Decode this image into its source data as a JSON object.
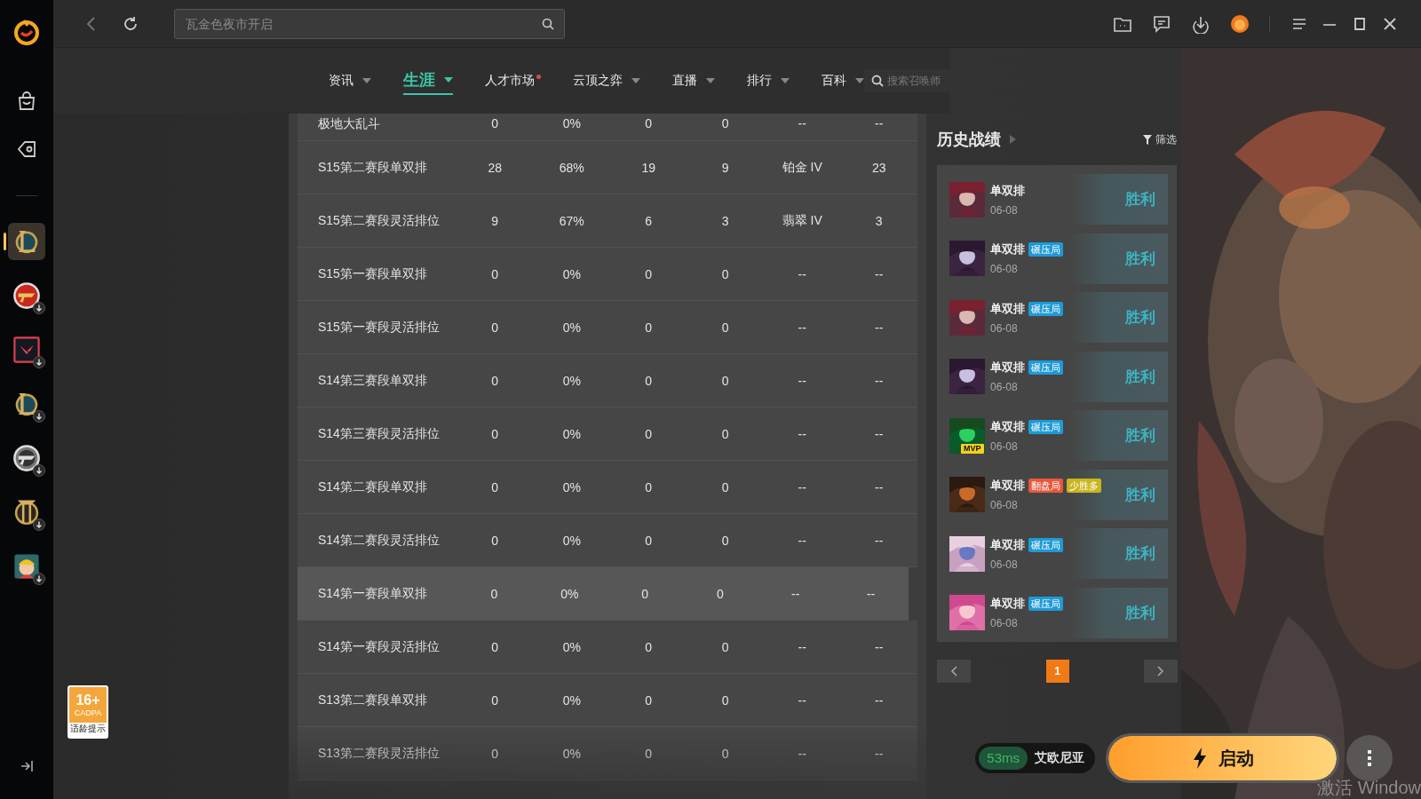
{
  "sidebar": {
    "games": [
      {
        "kind": "ring",
        "selected": true,
        "installed": true
      },
      {
        "kind": "badge",
        "selected": false,
        "installed": false
      },
      {
        "kind": "square",
        "selected": false,
        "installed": false
      },
      {
        "kind": "ring",
        "selected": false,
        "installed": false
      },
      {
        "kind": "silver",
        "selected": false,
        "installed": false
      },
      {
        "kind": "gate",
        "selected": false,
        "installed": false
      },
      {
        "kind": "tile",
        "selected": false,
        "installed": false
      }
    ],
    "age_rating": {
      "value": "16+",
      "org": "CADPA",
      "caption": "适龄提示"
    }
  },
  "top_bar": {
    "search": {
      "placeholder": "瓦金色夜市开启"
    }
  },
  "nav": {
    "items": [
      {
        "label": "资讯",
        "selected": false,
        "dropdown": true,
        "dot": false
      },
      {
        "label": "生涯",
        "selected": true,
        "dropdown": true,
        "dot": false
      },
      {
        "label": "人才市场",
        "selected": false,
        "dropdown": false,
        "dot": true
      },
      {
        "label": "云顶之弈",
        "selected": false,
        "dropdown": true,
        "dot": false
      },
      {
        "label": "直播",
        "selected": false,
        "dropdown": true,
        "dot": false
      },
      {
        "label": "排行",
        "selected": false,
        "dropdown": true,
        "dot": false
      },
      {
        "label": "百科",
        "selected": false,
        "dropdown": true,
        "dot": false
      }
    ],
    "search": {
      "placeholder": "搜索召唤师"
    }
  },
  "table": {
    "rows": [
      {
        "cells": [
          "极地大乱斗",
          "0",
          "0%",
          "0",
          "0",
          "--",
          "--"
        ],
        "selected": false
      },
      {
        "cells": [
          "S15第二赛段单双排",
          "28",
          "68%",
          "19",
          "9",
          "铂金 IV",
          "23"
        ],
        "selected": false
      },
      {
        "cells": [
          "S15第二赛段灵活排位",
          "9",
          "67%",
          "6",
          "3",
          "翡翠 IV",
          "3"
        ],
        "selected": false
      },
      {
        "cells": [
          "S15第一赛段单双排",
          "0",
          "0%",
          "0",
          "0",
          "--",
          "--"
        ],
        "selected": false
      },
      {
        "cells": [
          "S15第一赛段灵活排位",
          "0",
          "0%",
          "0",
          "0",
          "--",
          "--"
        ],
        "selected": false
      },
      {
        "cells": [
          "S14第三赛段单双排",
          "0",
          "0%",
          "0",
          "0",
          "--",
          "--"
        ],
        "selected": false
      },
      {
        "cells": [
          "S14第三赛段灵活排位",
          "0",
          "0%",
          "0",
          "0",
          "--",
          "--"
        ],
        "selected": false
      },
      {
        "cells": [
          "S14第二赛段单双排",
          "0",
          "0%",
          "0",
          "0",
          "--",
          "--"
        ],
        "selected": false
      },
      {
        "cells": [
          "S14第二赛段灵活排位",
          "0",
          "0%",
          "0",
          "0",
          "--",
          "--"
        ],
        "selected": false
      },
      {
        "cells": [
          "S14第一赛段单双排",
          "0",
          "0%",
          "0",
          "0",
          "--",
          "--"
        ],
        "selected": true
      },
      {
        "cells": [
          "S14第一赛段灵活排位",
          "0",
          "0%",
          "0",
          "0",
          "--",
          "--"
        ],
        "selected": false
      },
      {
        "cells": [
          "S13第二赛段单双排",
          "0",
          "0%",
          "0",
          "0",
          "--",
          "--"
        ],
        "selected": false
      },
      {
        "cells": [
          "S13第二赛段灵活排位",
          "0",
          "0%",
          "0",
          "0",
          "--",
          "--"
        ],
        "selected": false
      }
    ]
  },
  "history": {
    "title": "历史战绩",
    "filter": "筛选",
    "matches": [
      {
        "mode": "单双排",
        "date": "06-08",
        "result": "胜利"
      },
      {
        "mode": "单双排",
        "tags": [
          {
            "label": "碾压局",
            "color": "#1e9ad6"
          }
        ],
        "date": "06-08",
        "result": "胜利"
      },
      {
        "mode": "单双排",
        "tags": [
          {
            "label": "碾压局",
            "color": "#1e9ad6"
          }
        ],
        "date": "06-08",
        "result": "胜利"
      },
      {
        "mode": "单双排",
        "tags": [
          {
            "label": "碾压局",
            "color": "#1e9ad6"
          }
        ],
        "date": "06-08",
        "result": "胜利"
      },
      {
        "mode": "单双排",
        "tags": [
          {
            "label": "碾压局",
            "color": "#1e9ad6"
          }
        ],
        "date": "06-08",
        "result": "胜利",
        "badge": "MVP"
      },
      {
        "mode": "单双排",
        "tags": [
          {
            "label": "翻盘局",
            "color": "#e8573a"
          },
          {
            "label": "少胜多",
            "color": "#c9b51e"
          }
        ],
        "date": "06-08",
        "result": "胜利"
      },
      {
        "mode": "单双排",
        "tags": [
          {
            "label": "碾压局",
            "color": "#1e9ad6"
          }
        ],
        "date": "06-08",
        "result": "胜利"
      },
      {
        "mode": "单双排",
        "tags": [
          {
            "label": "碾压局",
            "color": "#1e9ad6"
          }
        ],
        "date": "06-08",
        "result": "胜利"
      }
    ],
    "pages": [
      {
        "label": "1",
        "selected": true
      }
    ]
  },
  "launch": {
    "ping": "53ms",
    "server": "艾欧尼亚",
    "button": "启动"
  },
  "os_notice": "激活 Window"
}
